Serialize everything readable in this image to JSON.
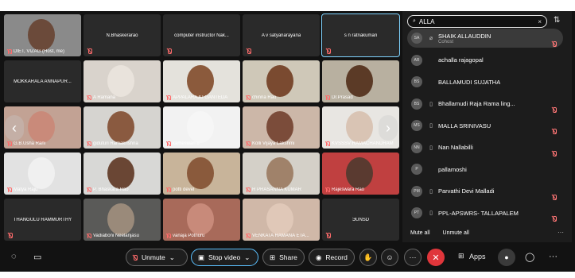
{
  "tiles": [
    {
      "name": "DIET, VIZAG (Host, me)",
      "mode": "video",
      "bg": "#8a8a8a",
      "face": "#6b4a3a"
    },
    {
      "name": "N.Bhaskerarao",
      "mode": "name"
    },
    {
      "name": "computer instructor Nak...",
      "mode": "name"
    },
    {
      "name": "A v satyanarayana",
      "mode": "name"
    },
    {
      "name": "s n ratnakumari",
      "mode": "name",
      "active": true
    },
    {
      "name": "MOKKARALA ANNAPUR...",
      "mode": "name"
    },
    {
      "name": "A Ramana",
      "mode": "video",
      "bg": "#d9d3cc",
      "face": "#e9e3dc"
    },
    {
      "name": "APPALARAJU GANTEDA",
      "mode": "video",
      "bg": "#e4e2dc",
      "face": "#8b5a3c"
    },
    {
      "name": "chinna Rao",
      "mode": "video",
      "bg": "#cfc8b8",
      "face": "#7a4a30"
    },
    {
      "name": "Dr.Prasad",
      "mode": "video",
      "bg": "#b8b0a0",
      "face": "#5b3a26"
    },
    {
      "name": "G.B.Usha Rani",
      "mode": "video",
      "bg": "#c2a294",
      "face": "#c98a7a"
    },
    {
      "name": "giduturi Ramakrishna",
      "mode": "video",
      "bg": "#d6d4d0",
      "face": "#8a5a40"
    },
    {
      "name": "kameswari u",
      "mode": "video",
      "bg": "#f2f2f2",
      "face": "#f6f6f6"
    },
    {
      "name": "Kolli Vijaya Lakshmi",
      "mode": "video",
      "bg": "#ccb7a8",
      "face": "#7b4c3a"
    },
    {
      "name": "KVSSSV RAMACHANDRAM",
      "mode": "video",
      "bg": "#e8e6e2",
      "face": "#d9c4b4"
    },
    {
      "name": "Matya Raju",
      "mode": "video",
      "bg": "#e2e2e2",
      "face": "#f0f0f0"
    },
    {
      "name": "P. Bhaskara Rao",
      "mode": "video",
      "bg": "#d8d8d6",
      "face": "#6a4634"
    },
    {
      "name": "potti devel",
      "mode": "video",
      "bg": "#c8b49a",
      "face": "#8a5a3c"
    },
    {
      "name": "R PRASANNA KUMAR",
      "mode": "video",
      "bg": "#d4d0c8",
      "face": "#a0826a"
    },
    {
      "name": "Rajeswara Rao",
      "mode": "video",
      "bg": "#c04040",
      "face": "#5a3a30"
    },
    {
      "name": "THANGULU RAMMURTHY",
      "mode": "name"
    },
    {
      "name": "Vadiaboni Neelanjasu",
      "mode": "video",
      "bg": "#5a5a58",
      "face": "#9a8a7a"
    },
    {
      "name": "vanaja Potnuru",
      "mode": "video",
      "bg": "#a86a5a",
      "face": "#c88a7a"
    },
    {
      "name": "VENKATA RAMANA ETA...",
      "mode": "video",
      "bg": "#d0b8a8",
      "face": "#e0c8b8"
    },
    {
      "name": "ЭUNSD",
      "mode": "name"
    }
  ],
  "nav": {
    "prev": "‹",
    "next": "›"
  },
  "search": {
    "query": "ALLA",
    "clear": "×",
    "sort_icon": "⇅"
  },
  "participants": [
    {
      "initials": "SA",
      "name": "SHAIK ALLAUDDIN",
      "sub": "Cohost",
      "device": "⌀",
      "muted": true,
      "selected": true
    },
    {
      "initials": "AR",
      "name": "achalla rajagopal",
      "device": "",
      "muted": false
    },
    {
      "initials": "BS",
      "name": "BALLAMUDI SUJATHA",
      "device": "",
      "muted": false
    },
    {
      "initials": "BS",
      "name": "Bhallamudi Raja Rama ling...",
      "device": "▯",
      "muted": true
    },
    {
      "initials": "MS",
      "name": "MALLA SRINIVASU",
      "device": "▯",
      "muted": true
    },
    {
      "initials": "NN",
      "name": "Nan Nallabilli",
      "device": "▯",
      "muted": true
    },
    {
      "initials": "P",
      "name": "pallamoshi",
      "device": "",
      "muted": false
    },
    {
      "initials": "PM",
      "name": "Parvathi Devi Malladi",
      "device": "▯",
      "muted": true
    },
    {
      "initials": "PT",
      "name": "PPL-APSWRS-  TALLAPALEM",
      "device": "▯",
      "muted": true
    }
  ],
  "panel_footer": {
    "mute_all": "Mute all",
    "unmute_all": "Unmute all",
    "more": "···"
  },
  "toolbar": {
    "unmute": "Unmute",
    "stop_video": "Stop video",
    "share": "Share",
    "record": "Record",
    "apps": "Apps",
    "more": "···",
    "leave": "✕",
    "chevron": "⌄"
  },
  "colors": {
    "accent": "#5bc1ff",
    "leave": "#e0363b",
    "muted": "#ff6b6b"
  }
}
